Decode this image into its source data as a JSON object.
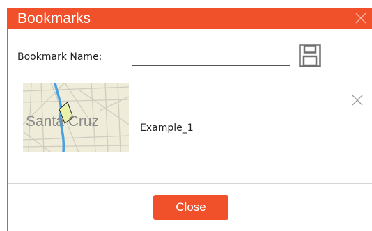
{
  "dialog": {
    "title": "Bookmarks",
    "close_icon": "close-icon",
    "accent_color": "#f0502a"
  },
  "name_field": {
    "label": "Bookmark Name:",
    "value": "",
    "placeholder": ""
  },
  "save_icon": "save-icon",
  "bookmarks": [
    {
      "name": "Example_1",
      "thumbnail_text": "Santa Cruz",
      "remove_icon": "close-icon"
    }
  ],
  "footer": {
    "close_label": "Close"
  }
}
